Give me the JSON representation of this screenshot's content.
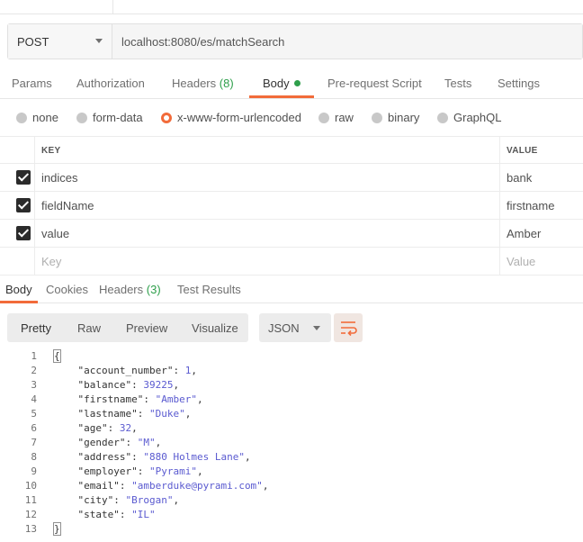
{
  "request": {
    "method": "POST",
    "url": "localhost:8080/es/matchSearch"
  },
  "request_tabs": [
    {
      "label": "Params"
    },
    {
      "label": "Authorization"
    },
    {
      "label": "Headers",
      "count": "(8)"
    },
    {
      "label": "Body"
    },
    {
      "label": "Pre-request Script"
    },
    {
      "label": "Tests"
    },
    {
      "label": "Settings"
    }
  ],
  "body_types": [
    "none",
    "form-data",
    "x-www-form-urlencoded",
    "raw",
    "binary",
    "GraphQL"
  ],
  "body_type_selected": "x-www-form-urlencoded",
  "kv_table": {
    "headers": {
      "key": "KEY",
      "value": "VALUE"
    },
    "rows": [
      {
        "key": "indices",
        "value": "bank",
        "checked": true
      },
      {
        "key": "fieldName",
        "value": "firstname",
        "checked": true
      },
      {
        "key": "value",
        "value": "Amber",
        "checked": true
      }
    ],
    "placeholder": {
      "key": "Key",
      "value": "Value"
    }
  },
  "response_tabs": [
    {
      "label": "Body"
    },
    {
      "label": "Cookies"
    },
    {
      "label": "Headers",
      "count": "(3)"
    },
    {
      "label": "Test Results"
    }
  ],
  "format_buttons": [
    "Pretty",
    "Raw",
    "Preview",
    "Visualize"
  ],
  "format_selected": "Pretty",
  "language": "JSON",
  "code_lines": [
    {
      "n": "1",
      "parts": [
        [
          "p",
          "{"
        ]
      ]
    },
    {
      "n": "2",
      "parts": [
        [
          "p",
          "    "
        ],
        [
          "k",
          "\"account_number\""
        ],
        [
          "p",
          ": "
        ],
        [
          "n",
          "1"
        ],
        [
          "p",
          ","
        ]
      ]
    },
    {
      "n": "3",
      "parts": [
        [
          "p",
          "    "
        ],
        [
          "k",
          "\"balance\""
        ],
        [
          "p",
          ": "
        ],
        [
          "n",
          "39225"
        ],
        [
          "p",
          ","
        ]
      ]
    },
    {
      "n": "4",
      "parts": [
        [
          "p",
          "    "
        ],
        [
          "k",
          "\"firstname\""
        ],
        [
          "p",
          ": "
        ],
        [
          "s",
          "\"Amber\""
        ],
        [
          "p",
          ","
        ]
      ]
    },
    {
      "n": "5",
      "parts": [
        [
          "p",
          "    "
        ],
        [
          "k",
          "\"lastname\""
        ],
        [
          "p",
          ": "
        ],
        [
          "s",
          "\"Duke\""
        ],
        [
          "p",
          ","
        ]
      ]
    },
    {
      "n": "6",
      "parts": [
        [
          "p",
          "    "
        ],
        [
          "k",
          "\"age\""
        ],
        [
          "p",
          ": "
        ],
        [
          "n",
          "32"
        ],
        [
          "p",
          ","
        ]
      ]
    },
    {
      "n": "7",
      "parts": [
        [
          "p",
          "    "
        ],
        [
          "k",
          "\"gender\""
        ],
        [
          "p",
          ": "
        ],
        [
          "s",
          "\"M\""
        ],
        [
          "p",
          ","
        ]
      ]
    },
    {
      "n": "8",
      "parts": [
        [
          "p",
          "    "
        ],
        [
          "k",
          "\"address\""
        ],
        [
          "p",
          ": "
        ],
        [
          "s",
          "\"880 Holmes Lane\""
        ],
        [
          "p",
          ","
        ]
      ]
    },
    {
      "n": "9",
      "parts": [
        [
          "p",
          "    "
        ],
        [
          "k",
          "\"employer\""
        ],
        [
          "p",
          ": "
        ],
        [
          "s",
          "\"Pyrami\""
        ],
        [
          "p",
          ","
        ]
      ]
    },
    {
      "n": "10",
      "parts": [
        [
          "p",
          "    "
        ],
        [
          "k",
          "\"email\""
        ],
        [
          "p",
          ": "
        ],
        [
          "s",
          "\"amberduke@pyrami.com\""
        ],
        [
          "p",
          ","
        ]
      ]
    },
    {
      "n": "11",
      "parts": [
        [
          "p",
          "    "
        ],
        [
          "k",
          "\"city\""
        ],
        [
          "p",
          ": "
        ],
        [
          "s",
          "\"Brogan\""
        ],
        [
          "p",
          ","
        ]
      ]
    },
    {
      "n": "12",
      "parts": [
        [
          "p",
          "    "
        ],
        [
          "k",
          "\"state\""
        ],
        [
          "p",
          ": "
        ],
        [
          "s",
          "\"IL\""
        ]
      ]
    },
    {
      "n": "13",
      "parts": [
        [
          "p",
          "}"
        ]
      ]
    }
  ],
  "colors": {
    "accent": "#f26b3a",
    "count_green": "#2e9f4b",
    "json_value": "#5a5ad0"
  },
  "icons": {
    "method_dropdown": "chevron-down-icon",
    "body_indicator": "dot-icon",
    "wrap": "wrap-lines-icon",
    "checkbox": "checkbox-checked-icon"
  }
}
